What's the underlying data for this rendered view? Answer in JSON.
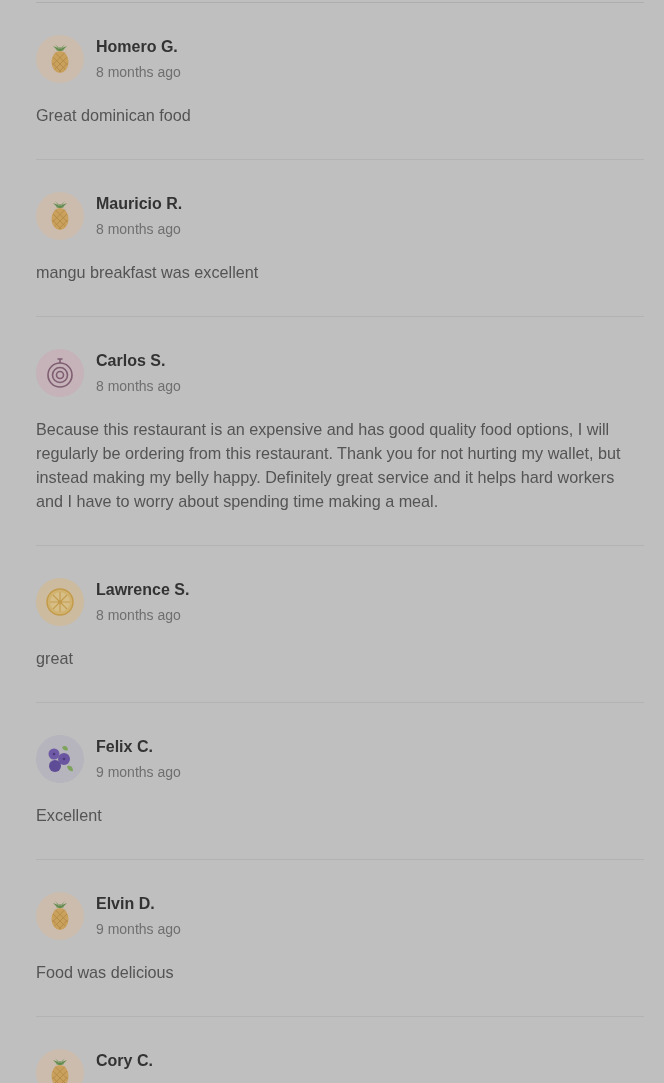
{
  "reviews": [
    {
      "name": "Homero G.",
      "time": "8 months ago",
      "text": "Great dominican food",
      "avatar": {
        "kind": "pineapple"
      }
    },
    {
      "name": "Mauricio R.",
      "time": "8 months ago",
      "text": "mangu breakfast was excellent",
      "avatar": {
        "kind": "pineapple"
      }
    },
    {
      "name": "Carlos S.",
      "time": "8 months ago",
      "text": "Because this restaurant is an expensive and has good quality food options, I will regularly be ordering from this restaurant. Thank you for not hurting my wallet, but instead making my belly happy. Definitely great service and it helps hard workers and I have to worry about spending time making a meal.",
      "avatar": {
        "kind": "onion"
      }
    },
    {
      "name": "Lawrence S.",
      "time": "8 months ago",
      "text": "great",
      "avatar": {
        "kind": "citrus"
      }
    },
    {
      "name": "Felix C.",
      "time": "9 months ago",
      "text": "Excellent",
      "avatar": {
        "kind": "blueberry"
      }
    },
    {
      "name": "Elvin D.",
      "time": "9 months ago",
      "text": "Food was delicious",
      "avatar": {
        "kind": "pineapple"
      }
    },
    {
      "name": "Cory C.",
      "avatar": {
        "kind": "pineapple"
      }
    }
  ]
}
